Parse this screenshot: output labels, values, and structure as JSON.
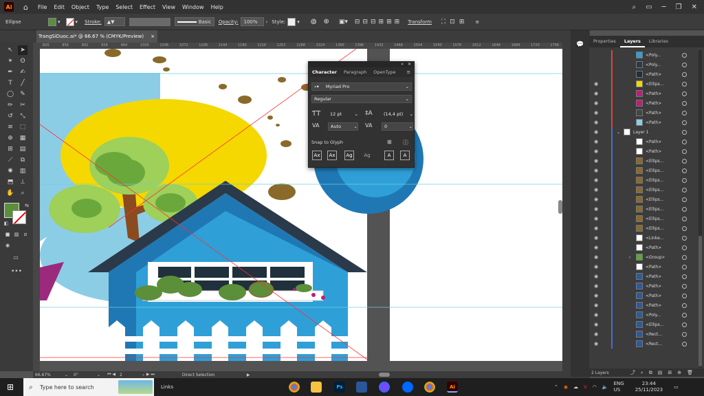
{
  "app": {
    "logo": "Ai"
  },
  "menu": [
    "File",
    "Edit",
    "Object",
    "Type",
    "Select",
    "Effect",
    "View",
    "Window",
    "Help"
  ],
  "control_bar": {
    "object_type": "Ellipse",
    "fill_color": "#5b8f3a",
    "stroke_label": "Stroke:",
    "stroke_style": "Basic",
    "opacity_label": "Opacity:",
    "opacity_value": "100%",
    "style_label": "Style:",
    "transform_label": "Transform"
  },
  "document_tab": {
    "title": "TrangSiDuoc.ai* @ 66.67 % (CMYK/Preview)",
    "close": "×"
  },
  "ruler_ticks": [
    "820",
    "856",
    "892",
    "928",
    "964",
    "1000",
    "1036",
    "1072",
    "1108",
    "1144",
    "1180",
    "1216",
    "1252",
    "1288",
    "1324",
    "1360",
    "1396",
    "1432",
    "1468",
    "1504",
    "1540",
    "1576",
    "1612",
    "1648",
    "1684",
    "1720",
    "1756"
  ],
  "status_bar": {
    "zoom": "66.67%",
    "rotation": "0°",
    "artboard": "2",
    "tool": "Direct Selection"
  },
  "character_panel": {
    "tabs": [
      "Character",
      "Paragraph",
      "OpenType"
    ],
    "font_family": "Myriad Pro",
    "font_style": "Regular",
    "font_size": "12 pt",
    "leading": "(14,4 pt)",
    "kerning": "Auto",
    "tracking": "0",
    "snap_label": "Snap to Glyph",
    "snap_glyphs": [
      "Ax",
      "Ax",
      "Ag",
      "Ag",
      "A",
      "A"
    ]
  },
  "layers_panel": {
    "tabs": [
      "Properties",
      "Layers",
      "Libraries"
    ],
    "rows": [
      {
        "name": "<Poly...",
        "thumb": "#2f9fd8",
        "eye": false,
        "bar": "#d9463e"
      },
      {
        "name": "<Poly...",
        "thumb": "#2b3a4a",
        "eye": false,
        "bar": "#d9463e"
      },
      {
        "name": "<Path>",
        "thumb": "#20303c",
        "eye": false,
        "bar": "#d9463e"
      },
      {
        "name": "<Ellips...",
        "thumb": "#f5d800",
        "eye": true,
        "bar": "#d9463e"
      },
      {
        "name": "<Path>",
        "thumb": "#c21b7a",
        "eye": true,
        "bar": "#d9463e"
      },
      {
        "name": "<Path>",
        "thumb": "#c21b7a",
        "eye": true,
        "bar": "#d9463e"
      },
      {
        "name": "<Path>",
        "thumb": "#444444",
        "eye": true,
        "bar": "#d9463e"
      },
      {
        "name": "<Path>",
        "thumb": "#8ccde6",
        "eye": true,
        "bar": "#d9463e"
      },
      {
        "name": "Layer 1",
        "thumb": "#ffffff",
        "eye": true,
        "bar": "#4a6cd4",
        "layer": true
      },
      {
        "name": "<Path>",
        "thumb": "#ffffff",
        "eye": true,
        "bar": "#4a6cd4"
      },
      {
        "name": "<Path>",
        "thumb": "#ffffff",
        "eye": true,
        "bar": "#4a6cd4"
      },
      {
        "name": "<Ellips...",
        "thumb": "#8a6a2a",
        "eye": true,
        "bar": "#4a6cd4"
      },
      {
        "name": "<Ellips...",
        "thumb": "#8a6a2a",
        "eye": true,
        "bar": "#4a6cd4"
      },
      {
        "name": "<Ellips...",
        "thumb": "#8a6a2a",
        "eye": true,
        "bar": "#4a6cd4"
      },
      {
        "name": "<Ellips...",
        "thumb": "#8a6a2a",
        "eye": true,
        "bar": "#4a6cd4"
      },
      {
        "name": "<Ellips...",
        "thumb": "#8a6a2a",
        "eye": true,
        "bar": "#4a6cd4"
      },
      {
        "name": "<Ellips...",
        "thumb": "#8a6a2a",
        "eye": true,
        "bar": "#4a6cd4"
      },
      {
        "name": "<Ellips...",
        "thumb": "#8a6a2a",
        "eye": true,
        "bar": "#4a6cd4"
      },
      {
        "name": "<Ellips...",
        "thumb": "#8a6a2a",
        "eye": true,
        "bar": "#4a6cd4"
      },
      {
        "name": "<Linke...",
        "thumb": "#ffffff",
        "eye": true,
        "bar": "#4a6cd4"
      },
      {
        "name": "<Path>",
        "thumb": "#ffffff",
        "eye": true,
        "bar": "#4a6cd4"
      },
      {
        "name": "<Group>",
        "thumb": "#5aaa3a",
        "eye": true,
        "bar": "#4a6cd4",
        "expand": true
      },
      {
        "name": "<Path>",
        "thumb": "#ffffff",
        "eye": true,
        "bar": "#4a6cd4"
      },
      {
        "name": "<Path>",
        "thumb": "#2a5aa0",
        "eye": true,
        "bar": "#4a6cd4"
      },
      {
        "name": "<Path>",
        "thumb": "#2a5aa0",
        "eye": true,
        "bar": "#4a6cd4"
      },
      {
        "name": "<Path>",
        "thumb": "#2a5aa0",
        "eye": true,
        "bar": "#4a6cd4"
      },
      {
        "name": "<Path>",
        "thumb": "#2a5aa0",
        "eye": true,
        "bar": "#4a6cd4"
      },
      {
        "name": "<Poly...",
        "thumb": "#2a5aa0",
        "eye": true,
        "bar": "#4a6cd4"
      },
      {
        "name": "<Ellips...",
        "thumb": "#2a5aa0",
        "eye": true,
        "bar": "#4a6cd4"
      },
      {
        "name": "<Rect...",
        "thumb": "#2a5aa0",
        "eye": true,
        "bar": "#4a6cd4"
      },
      {
        "name": "<Rect...",
        "thumb": "#2a5aa0",
        "eye": true,
        "bar": "#4a6cd4"
      }
    ],
    "footer": "2 Layers"
  },
  "taskbar": {
    "search_placeholder": "Type here to search",
    "links_label": "Links",
    "clock_time": "23:44",
    "clock_date": "25/11/2023",
    "lang": "ENG",
    "region": "US"
  }
}
